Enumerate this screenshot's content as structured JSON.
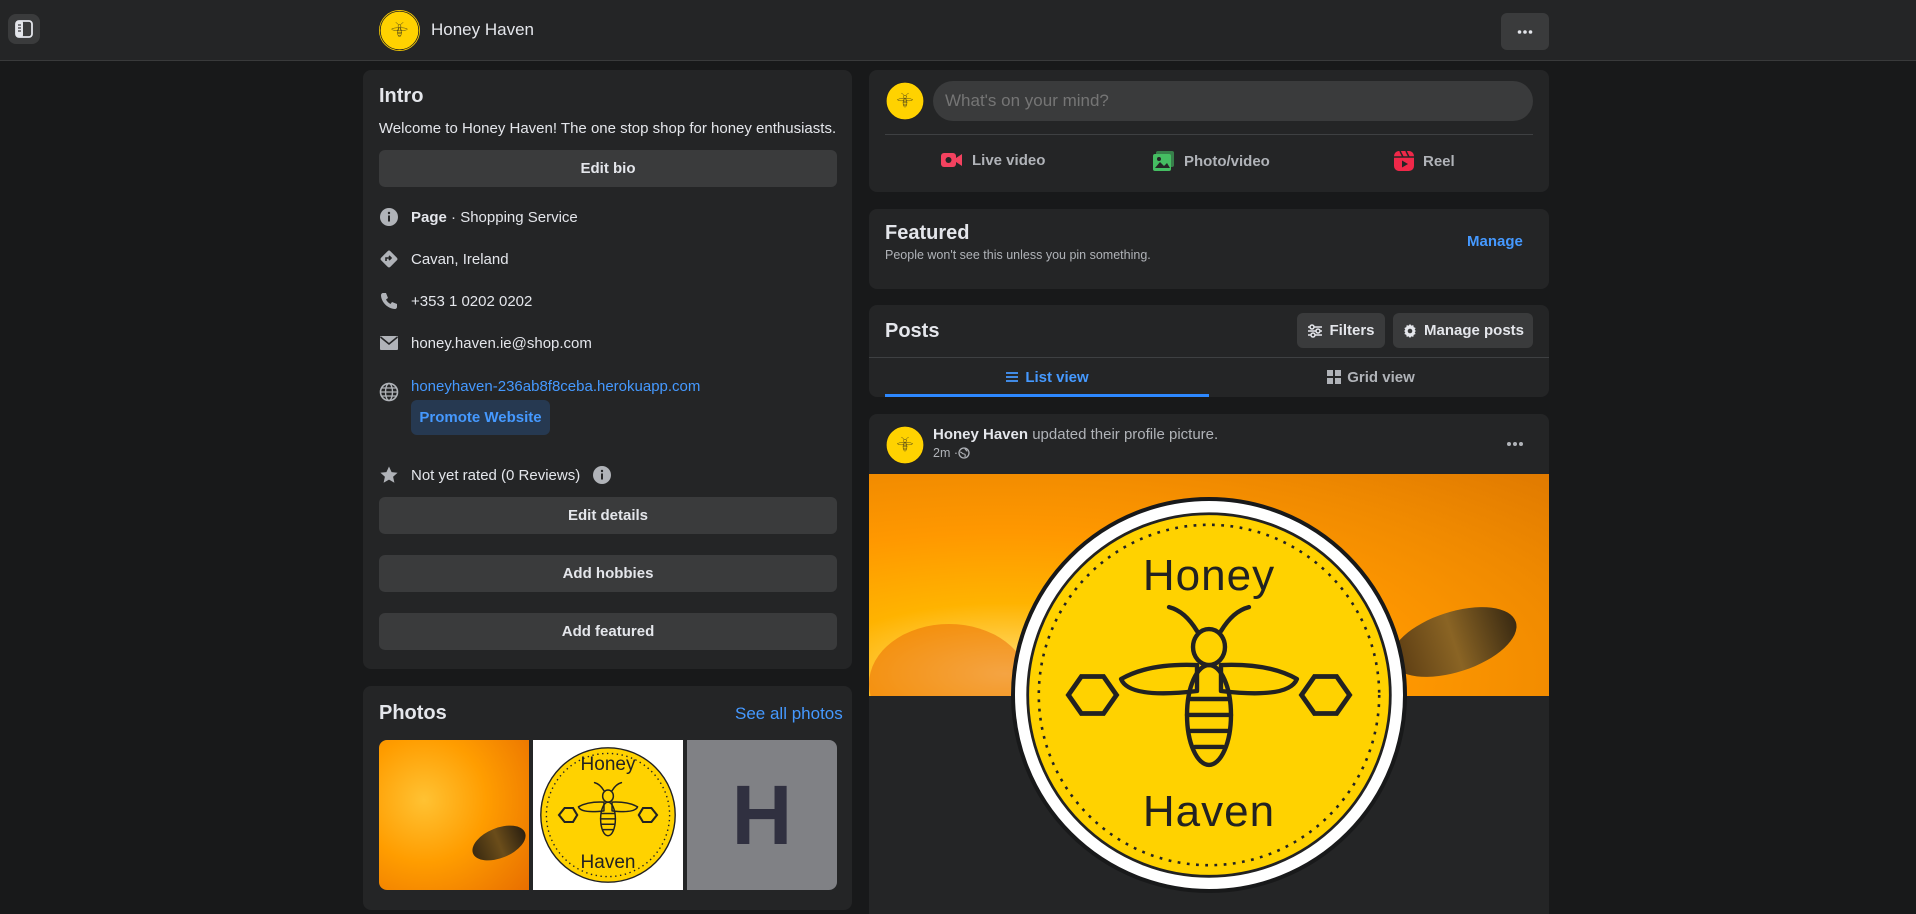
{
  "header": {
    "title": "Honey Haven"
  },
  "intro": {
    "heading": "Intro",
    "bio": "Welcome to Honey Haven! The one stop shop for honey enthusiasts.",
    "edit_bio": "Edit bio",
    "page_type_bold": "Page",
    "page_type_rest": " · Shopping Service",
    "location": "Cavan, Ireland",
    "phone": "+353 1 0202 0202",
    "email": "honey.haven.ie@shop.com",
    "website": "honeyhaven-236ab8f8ceba.herokuapp.com",
    "promote": "Promote Website",
    "rating": "Not yet rated (0 Reviews)",
    "edit_details": "Edit details",
    "add_hobbies": "Add hobbies",
    "add_featured": "Add featured"
  },
  "photos": {
    "heading": "Photos",
    "see_all": "See all photos",
    "letter_tile": "H"
  },
  "composer": {
    "placeholder": "What's on your mind?",
    "live": "Live video",
    "photo": "Photo/video",
    "reel": "Reel"
  },
  "featured": {
    "heading": "Featured",
    "subtitle": "People won't see this unless you pin something.",
    "manage": "Manage"
  },
  "posts": {
    "heading": "Posts",
    "filters": "Filters",
    "manage_posts": "Manage posts",
    "list_view": "List view",
    "grid_view": "Grid view"
  },
  "post": {
    "author": "Honey Haven",
    "action": " updated their profile picture.",
    "time": "2m · "
  },
  "logo": {
    "top": "Honey",
    "bottom": "Haven"
  },
  "colors": {
    "accent": "#2d88ff",
    "card": "#242526",
    "background": "#18191a",
    "brand_yellow": "#ffd200"
  }
}
